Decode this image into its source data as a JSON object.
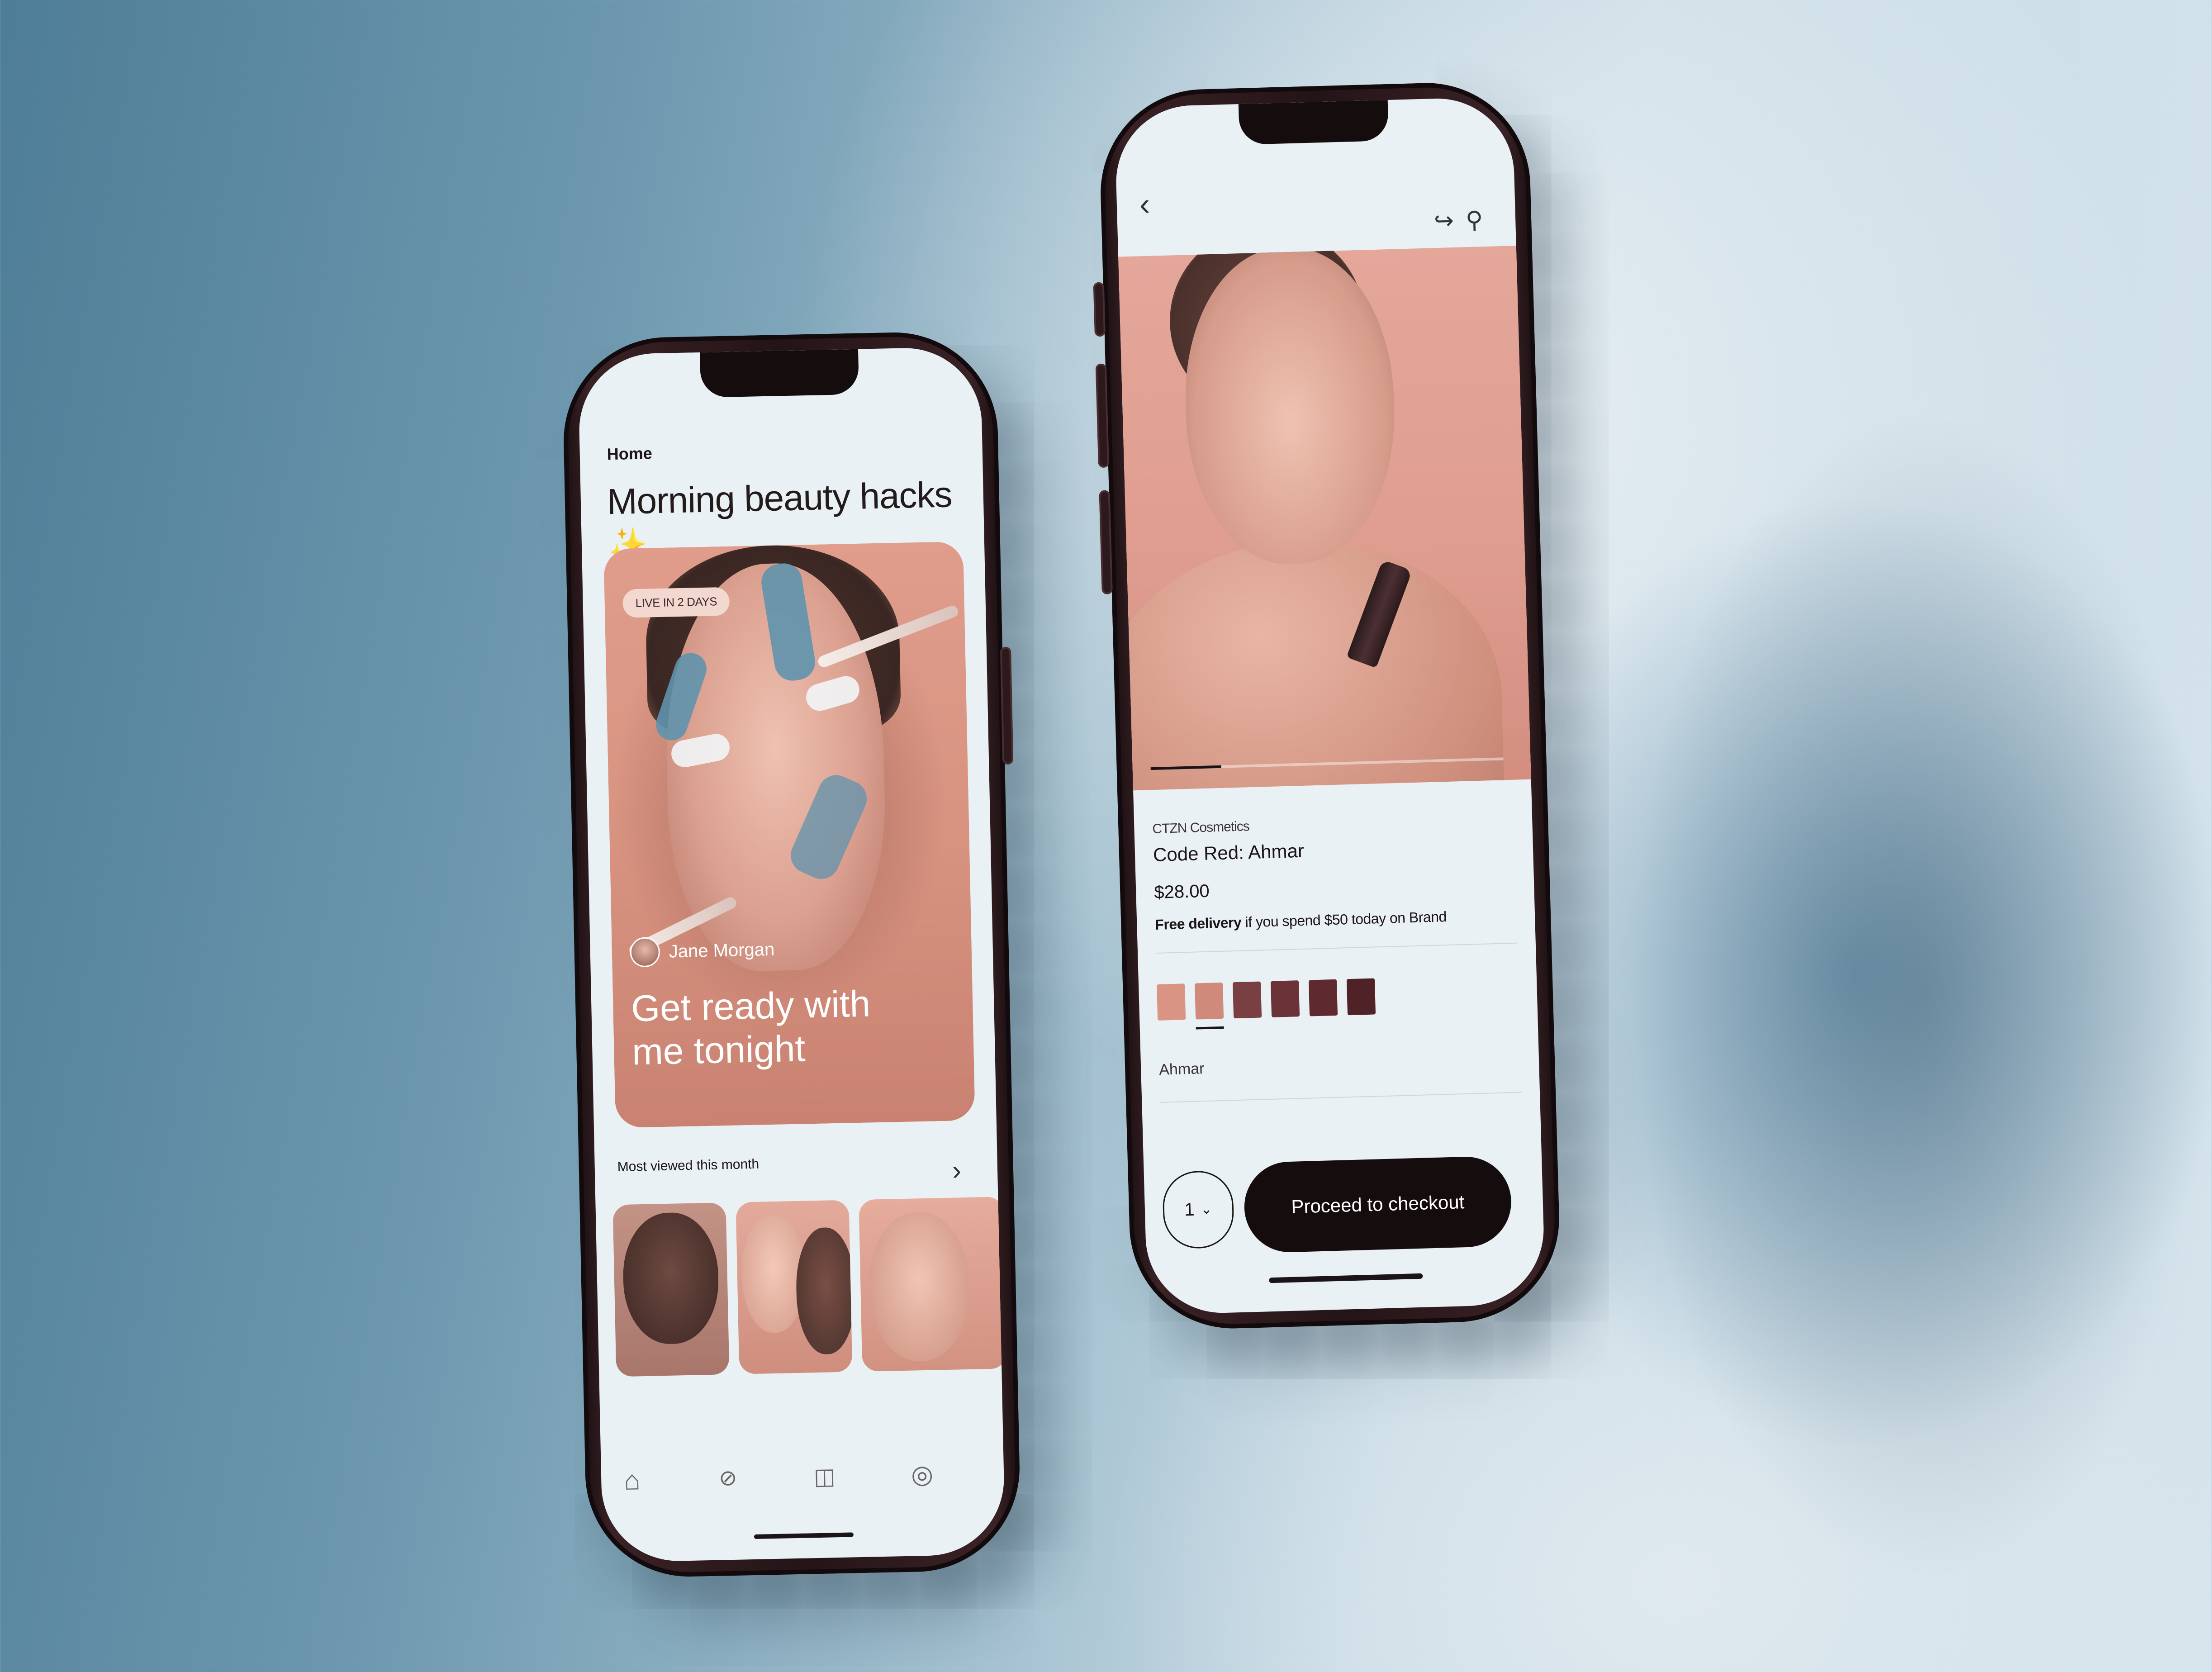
{
  "home_screen": {
    "breadcrumb": "Home",
    "title": "Morning beauty hacks",
    "title_emoji": "✨",
    "featured": {
      "badge": "LIVE IN 2 DAYS",
      "author": "Jane Morgan",
      "caption": "Get ready with me tonight"
    },
    "most_viewed_title": "Most viewed this month",
    "tabs": [
      {
        "name": "home",
        "icon": "home-icon"
      },
      {
        "name": "explore",
        "icon": "compass-icon"
      },
      {
        "name": "shop",
        "icon": "bag-icon"
      },
      {
        "name": "profile",
        "icon": "user-icon"
      }
    ]
  },
  "product_screen": {
    "brand": "CTZN Cosmetics",
    "product_name": "Code Red: Ahmar",
    "price": "$28.00",
    "delivery_bold": "Free delivery",
    "delivery_rest": " if you spend $50 today on Brand",
    "image_progress": 0.2,
    "swatches": [
      {
        "color": "#d99484",
        "selected": false
      },
      {
        "color": "#d08a7c",
        "selected": true
      },
      {
        "color": "#7a3f42",
        "selected": false
      },
      {
        "color": "#6b3337",
        "selected": false
      },
      {
        "color": "#5e2a2f",
        "selected": false
      },
      {
        "color": "#4f2227",
        "selected": false
      }
    ],
    "selected_shade": "Ahmar",
    "quantity": "1",
    "checkout_label": "Proceed to checkout"
  },
  "colors": {
    "accent_pink": "#df9c8d",
    "dark": "#150c0e",
    "screen_bg": "#e9f1f4"
  }
}
